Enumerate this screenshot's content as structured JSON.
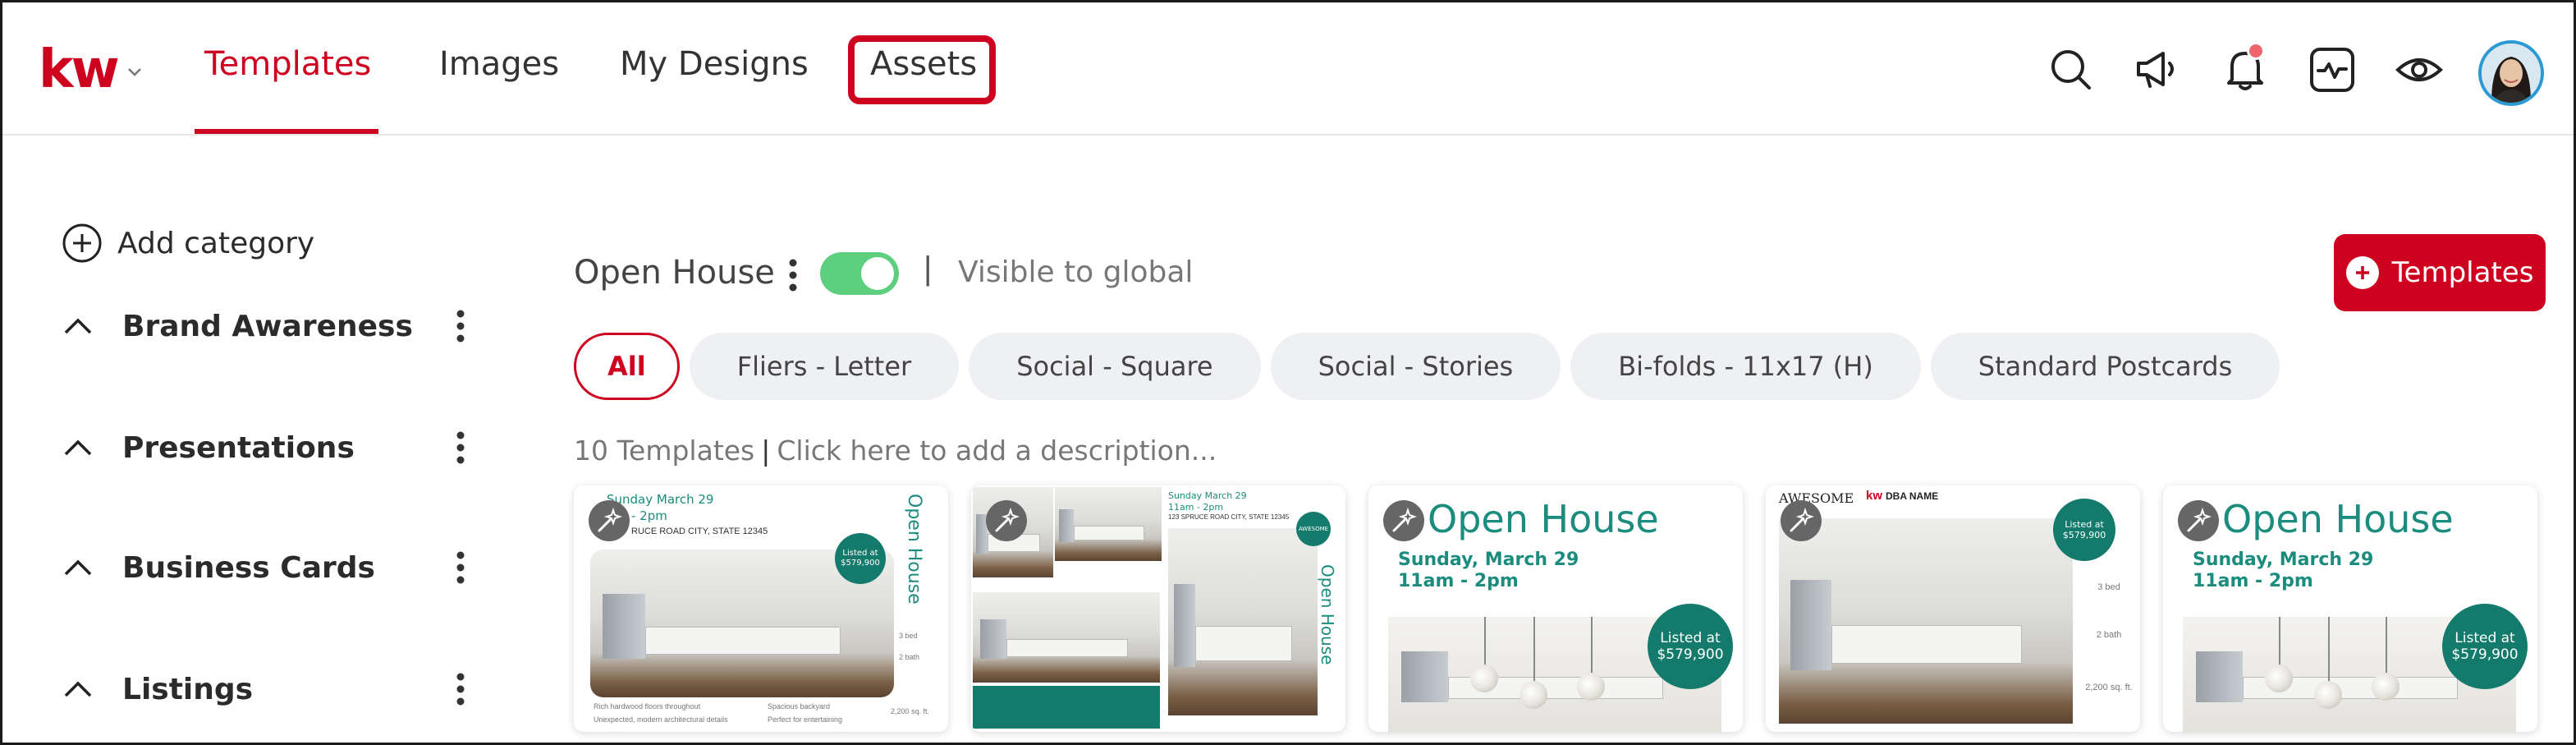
{
  "header": {
    "logo_text": "kw",
    "tabs": [
      {
        "label": "Templates",
        "active": true
      },
      {
        "label": "Images",
        "active": false
      },
      {
        "label": "My Designs",
        "active": false
      },
      {
        "label": "Assets",
        "active": false,
        "highlighted": true
      }
    ],
    "icons": [
      "search-icon",
      "megaphone-icon",
      "bell-icon",
      "activity-icon",
      "eye-icon",
      "avatar"
    ]
  },
  "sidebar": {
    "add_category_label": "Add category",
    "categories": [
      {
        "label": "Brand Awareness"
      },
      {
        "label": "Presentations"
      },
      {
        "label": "Business Cards"
      },
      {
        "label": "Listings"
      }
    ]
  },
  "main": {
    "category_title": "Open House",
    "toggle_on": true,
    "separator": "|",
    "visibility_text": "Visible to global",
    "add_button_label": "Templates",
    "filters": [
      {
        "label": "All",
        "active": true
      },
      {
        "label": "Fliers - Letter"
      },
      {
        "label": "Social - Square"
      },
      {
        "label": "Social - Stories"
      },
      {
        "label": "Bi-folds - 11x17 (H)"
      },
      {
        "label": "Standard Postcards"
      }
    ],
    "count_text": "10 Templates",
    "description_placeholder": "Click here to add a description..."
  },
  "cards": {
    "c1": {
      "date": "Sunday March 29",
      "time": "- 2pm",
      "address": "RUCE ROAD CITY, STATE 12345",
      "vertical": "Open House",
      "listed": "Listed at",
      "price": "$579,900",
      "beds": "3 bed",
      "baths": "2 bath",
      "sqft": "2,200 sq. ft.",
      "bullet1": "Rich hardwood floors throughout",
      "bullet2": "Unexpected, modern architectural details",
      "bullet3": "Spacious backyard",
      "bullet4": "Perfect for entertaining"
    },
    "c2": {
      "date": "Sunday March 29",
      "time": "11am - 2pm",
      "address": "123 SPRUCE ROAD CITY, STATE 12345",
      "vertical": "Open House",
      "tag": "AWESOME"
    },
    "c3": {
      "title": "Open House",
      "date": "Sunday, March 29",
      "time": "11am - 2pm",
      "listed": "Listed at",
      "price": "$579,900"
    },
    "c4": {
      "brand": "AWESOME",
      "dba": "DBA NAME",
      "listed": "Listed at",
      "price": "$579,900",
      "beds": "3 bed",
      "baths": "2 bath",
      "sqft": "2,200 sq. ft."
    },
    "c5": {
      "title": "Open House",
      "date": "Sunday, March 29",
      "time": "11am - 2pm",
      "listed": "Listed at",
      "price": "$579,900"
    }
  },
  "colors": {
    "brand_red": "#ce011f",
    "teal": "#1b8c7d",
    "toggle_green": "#5dcf7e",
    "chip_bg": "#eef0f3"
  }
}
